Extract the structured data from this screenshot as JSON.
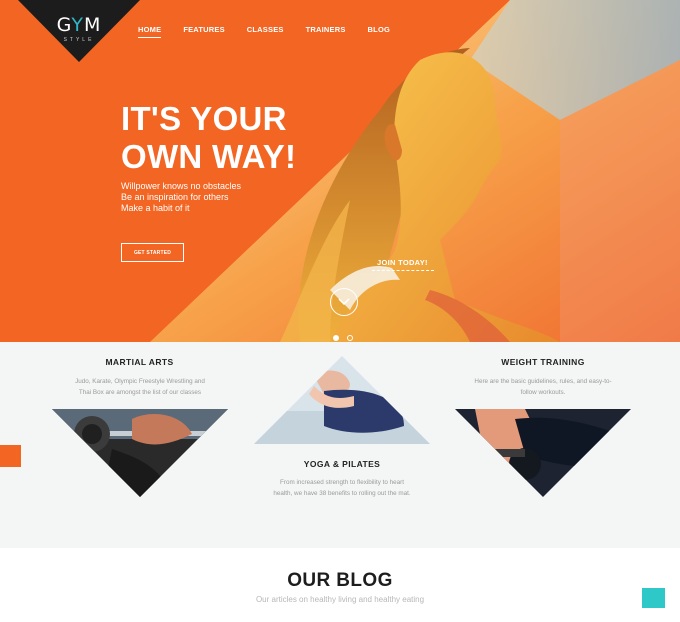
{
  "logo": {
    "letters_left": "G",
    "letter_y": "Y",
    "letters_right": "M",
    "sub": "STYLE"
  },
  "nav": {
    "items": [
      {
        "label": "HOME",
        "active": true
      },
      {
        "label": "FEATURES"
      },
      {
        "label": "CLASSES"
      },
      {
        "label": "TRAINERS"
      },
      {
        "label": "BLOG"
      }
    ]
  },
  "hero": {
    "headline_line1": "IT'S YOUR",
    "headline_line2": "OWN WAY!",
    "tagline": [
      "Willpower knows no obstacles",
      "Be an inspiration for others",
      "Make a habit of it"
    ],
    "cta_label": "GET STARTED",
    "join_label": "JOIN TODAY!",
    "scroll_icon": "chevron-down-icon",
    "slide_count": 2,
    "active_slide": 1
  },
  "services": [
    {
      "title": "MARTIAL ARTS",
      "text": [
        "Judo, Karate, Olympic Freestyle Wrestling and",
        "Thai Box are amongst the list of our classes"
      ]
    },
    {
      "title": "YOGA & PILATES",
      "text": [
        "From increased strength to flexibility to heart",
        "health, we have 38 benefits to rolling out the mat."
      ]
    },
    {
      "title": "WEIGHT TRAINING",
      "text": [
        "Here are the basic guidelines, rules, and easy-to-",
        "follow workouts."
      ]
    }
  ],
  "blog": {
    "title": "OUR BLOG",
    "subtitle": "Our articles on healthy living and healthy eating"
  },
  "colors": {
    "accent": "#f26522",
    "teal": "#2ec8c8",
    "dark": "#1d1d1d",
    "muted": "#9a9a9a"
  }
}
